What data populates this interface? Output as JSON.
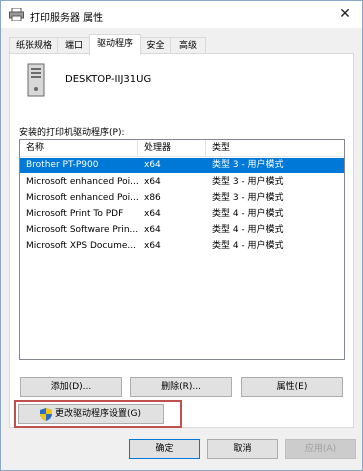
{
  "window": {
    "title": "打印服务器 属性",
    "close_glyph": "✕"
  },
  "tabs": [
    {
      "label": "纸张规格",
      "active": false
    },
    {
      "label": "端口",
      "active": false
    },
    {
      "label": "驱动程序",
      "active": true
    },
    {
      "label": "安全",
      "active": false
    },
    {
      "label": "高级",
      "active": false
    }
  ],
  "server": {
    "icon": "computer-tower-icon",
    "name": "DESKTOP-IIJ31UG"
  },
  "drivers": {
    "label": "安装的打印机驱动程序(P):",
    "columns": [
      "名称",
      "处理器",
      "类型"
    ],
    "rows": [
      {
        "name": "Brother PT-P900",
        "processor": "x64",
        "type": "类型 3 - 用户模式",
        "selected": true
      },
      {
        "name": "Microsoft enhanced Poi...",
        "processor": "x64",
        "type": "类型 3 - 用户模式",
        "selected": false
      },
      {
        "name": "Microsoft enhanced Poi...",
        "processor": "x86",
        "type": "类型 3 - 用户模式",
        "selected": false
      },
      {
        "name": "Microsoft Print To PDF",
        "processor": "x64",
        "type": "类型 4 - 用户模式",
        "selected": false
      },
      {
        "name": "Microsoft Software Prin...",
        "processor": "x64",
        "type": "类型 4 - 用户模式",
        "selected": false
      },
      {
        "name": "Microsoft XPS Docume...",
        "processor": "x64",
        "type": "类型 4 - 用户模式",
        "selected": false
      }
    ]
  },
  "actions": {
    "add": "添加(D)...",
    "remove": "删除(R)...",
    "properties": "属性(E)",
    "change_settings": "更改驱动程序设置(G)"
  },
  "footer": {
    "ok": "确定",
    "cancel": "取消",
    "apply": "应用(A)"
  },
  "colors": {
    "selection": "#0078d7",
    "highlight_box": "#c0504d"
  }
}
